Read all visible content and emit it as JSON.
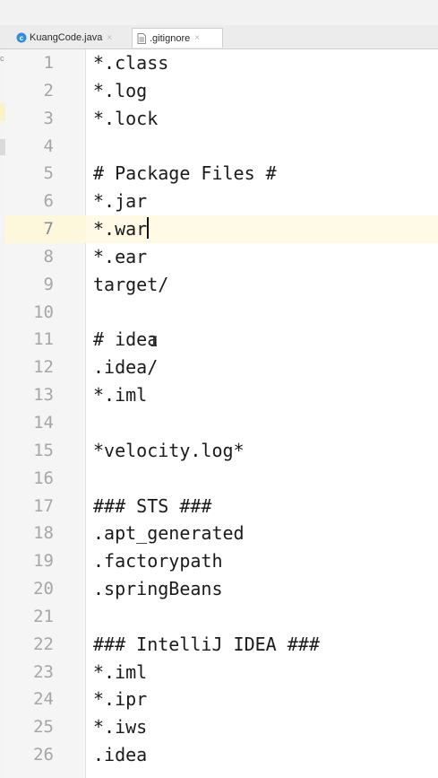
{
  "tabs": [
    {
      "label": "KuangCode.java",
      "icon": "java-class-icon",
      "close": "×",
      "active": false
    },
    {
      "label": ".gitignore",
      "icon": "text-file-icon",
      "close": "×",
      "active": true
    }
  ],
  "left_strip": {
    "letter": "c"
  },
  "editor": {
    "current_line": 7,
    "lines": [
      {
        "number": "1",
        "text": "*.class"
      },
      {
        "number": "2",
        "text": "*.log"
      },
      {
        "number": "3",
        "text": "*.lock"
      },
      {
        "number": "4",
        "text": ""
      },
      {
        "number": "5",
        "text": "# Package Files #"
      },
      {
        "number": "6",
        "text": "*.jar"
      },
      {
        "number": "7",
        "text": "*.war"
      },
      {
        "number": "8",
        "text": "*.ear"
      },
      {
        "number": "9",
        "text": "target/"
      },
      {
        "number": "10",
        "text": ""
      },
      {
        "number": "11",
        "text": "# idea"
      },
      {
        "number": "12",
        "text": ".idea/"
      },
      {
        "number": "13",
        "text": "*.iml"
      },
      {
        "number": "14",
        "text": ""
      },
      {
        "number": "15",
        "text": "*velocity.log*"
      },
      {
        "number": "16",
        "text": ""
      },
      {
        "number": "17",
        "text": "### STS ###"
      },
      {
        "number": "18",
        "text": ".apt_generated"
      },
      {
        "number": "19",
        "text": ".factorypath"
      },
      {
        "number": "20",
        "text": ".springBeans"
      },
      {
        "number": "21",
        "text": ""
      },
      {
        "number": "22",
        "text": "### IntelliJ IDEA ###"
      },
      {
        "number": "23",
        "text": "*.iml"
      },
      {
        "number": "24",
        "text": "*.ipr"
      },
      {
        "number": "25",
        "text": "*.iws"
      },
      {
        "number": "26",
        "text": ".idea"
      }
    ]
  },
  "colors": {
    "current_line_bg": "#fefae6",
    "gutter_bg": "#f5f5f5",
    "line_number": "#a6a6a6",
    "java_icon": "#2f8fd8"
  }
}
